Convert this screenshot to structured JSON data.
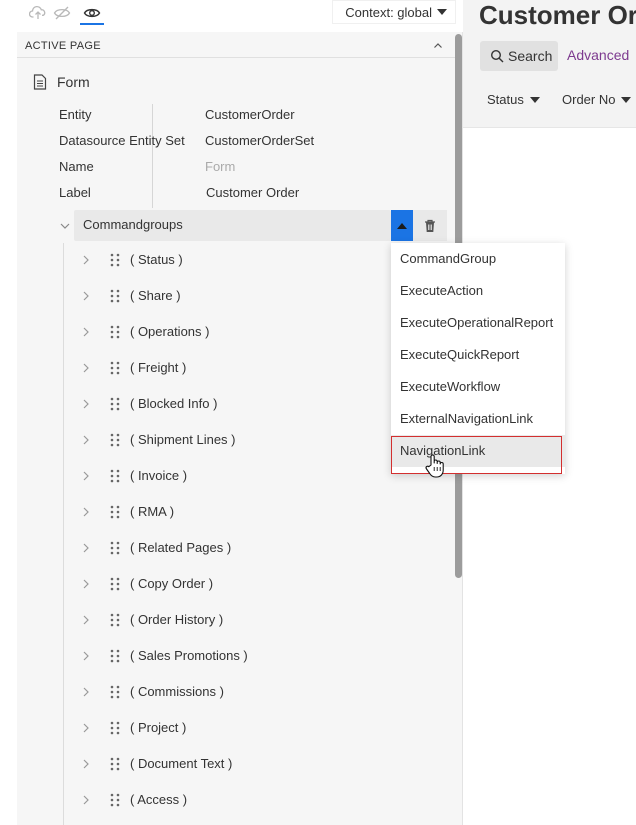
{
  "toolbar": {
    "context_label": "Context: global"
  },
  "section": {
    "title": "ACTIVE PAGE"
  },
  "form": {
    "label": "Form",
    "properties": [
      {
        "key": "Entity",
        "value": "CustomerOrder"
      },
      {
        "key": "Datasource Entity Set",
        "value": "CustomerOrderSet"
      },
      {
        "key": "Name",
        "value": "Form"
      },
      {
        "key": "Label",
        "value": "Customer Order"
      }
    ]
  },
  "commandgroups": {
    "label": "Commandgroups",
    "items": [
      {
        "label": "( Status )"
      },
      {
        "label": "( Share )"
      },
      {
        "label": "( Operations )"
      },
      {
        "label": "( Freight )"
      },
      {
        "label": "( Blocked Info )"
      },
      {
        "label": "( Shipment Lines )"
      },
      {
        "label": "( Invoice )"
      },
      {
        "label": "( RMA )"
      },
      {
        "label": "( Related Pages )"
      },
      {
        "label": "( Copy Order )"
      },
      {
        "label": "( Order History )"
      },
      {
        "label": "( Sales Promotions )"
      },
      {
        "label": "( Commissions )"
      },
      {
        "label": "( Project )"
      },
      {
        "label": "( Document Text )"
      },
      {
        "label": "( Access )"
      }
    ]
  },
  "dropdown": {
    "items": [
      {
        "label": "CommandGroup"
      },
      {
        "label": "ExecuteAction"
      },
      {
        "label": "ExecuteOperationalReport"
      },
      {
        "label": "ExecuteQuickReport"
      },
      {
        "label": "ExecuteWorkflow"
      },
      {
        "label": "ExternalNavigationLink"
      },
      {
        "label": "NavigationLink"
      }
    ],
    "hovered_index": 6
  },
  "right_page": {
    "title": "Customer Or",
    "search_label": "Search",
    "advanced_label": "Advanced",
    "columns": [
      "Status",
      "Order No"
    ]
  },
  "colors": {
    "accent": "#1b74e4",
    "highlight_border": "#d32f2f",
    "advanced_link": "#7d3a8f"
  }
}
